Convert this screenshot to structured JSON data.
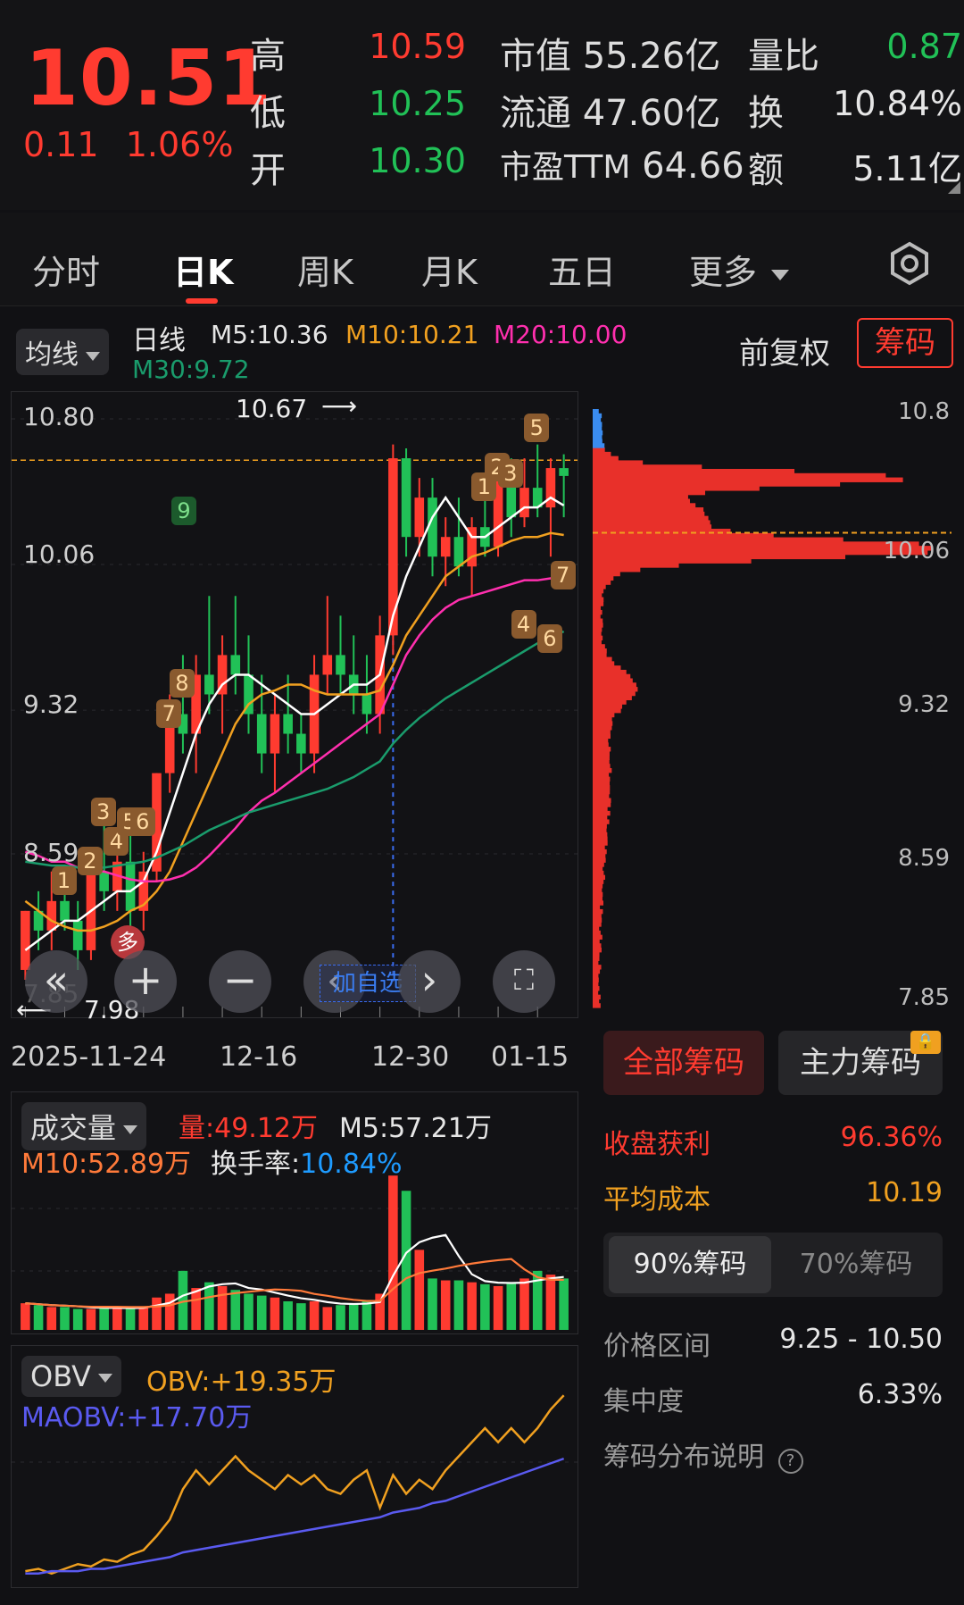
{
  "quote": {
    "price": "10.51",
    "change": "0.11",
    "change_pct": "1.06%",
    "high_label": "高",
    "high": "10.59",
    "low_label": "低",
    "low": "10.25",
    "open_label": "开",
    "open": "10.30",
    "mktcap_label": "市值",
    "mktcap": "55.26亿",
    "float_label": "流通",
    "float": "47.60亿",
    "pe_label": "市盈TTM",
    "pe": "64.66",
    "vol_ratio_label": "量比",
    "vol_ratio": "0.87",
    "turnover_label": "换",
    "turnover": "10.84%",
    "amount_label": "额",
    "amount": "5.11亿"
  },
  "tabs": [
    "分时",
    "日K",
    "周K",
    "月K",
    "五日",
    "更多"
  ],
  "indicator": {
    "selector": "均线",
    "type": "日线",
    "m5": "M5:10.36",
    "m10": "M10:10.21",
    "m20": "M20:10.00",
    "m30": "M30:9.72",
    "adjust": "前复权",
    "chips_btn": "筹码"
  },
  "main_chart": {
    "y_labels": [
      "10.80",
      "10.06",
      "9.32",
      "8.59",
      "7.85"
    ],
    "x_labels": [
      "2025-11-24",
      "12-16",
      "12-30",
      "01-15"
    ],
    "max_label": "10.67",
    "min_label": "7.98",
    "duo_badge": "多",
    "add_watch": "加自选",
    "marker_top9": "9",
    "markers_red": [
      "1",
      "2",
      "3",
      "4",
      "5",
      "6",
      "7",
      "8"
    ],
    "markers_right": [
      "1",
      "2",
      "3",
      "5",
      "7",
      "4",
      "6"
    ]
  },
  "chart_data": {
    "type": "candlestick",
    "x_labels": [
      "2025-11-24",
      "12-16",
      "12-30",
      "01-15"
    ],
    "ylim": [
      7.85,
      10.8
    ],
    "candles": [
      [
        8.0,
        8.3,
        7.95,
        8.3
      ],
      [
        8.3,
        8.4,
        8.1,
        8.2
      ],
      [
        8.2,
        8.5,
        8.1,
        8.35
      ],
      [
        8.35,
        8.45,
        8.2,
        8.25
      ],
      [
        8.25,
        8.35,
        8.0,
        8.1
      ],
      [
        8.1,
        8.6,
        8.05,
        8.5
      ],
      [
        8.5,
        8.8,
        8.3,
        8.4
      ],
      [
        8.4,
        8.7,
        8.3,
        8.55
      ],
      [
        8.55,
        8.7,
        8.2,
        8.3
      ],
      [
        8.3,
        8.6,
        8.2,
        8.5
      ],
      [
        8.5,
        9.0,
        8.45,
        9.0
      ],
      [
        9.0,
        9.4,
        8.9,
        9.3
      ],
      [
        9.3,
        9.6,
        9.1,
        9.2
      ],
      [
        9.2,
        9.6,
        9.0,
        9.5
      ],
      [
        9.5,
        9.9,
        9.3,
        9.4
      ],
      [
        9.4,
        9.7,
        9.2,
        9.6
      ],
      [
        9.6,
        9.9,
        9.4,
        9.5
      ],
      [
        9.5,
        9.7,
        9.2,
        9.3
      ],
      [
        9.3,
        9.5,
        9.0,
        9.1
      ],
      [
        9.1,
        9.4,
        8.9,
        9.3
      ],
      [
        9.3,
        9.5,
        9.1,
        9.2
      ],
      [
        9.2,
        9.3,
        9.0,
        9.1
      ],
      [
        9.1,
        9.6,
        9.0,
        9.5
      ],
      [
        9.5,
        9.9,
        9.4,
        9.6
      ],
      [
        9.6,
        9.8,
        9.4,
        9.5
      ],
      [
        9.5,
        9.7,
        9.3,
        9.4
      ],
      [
        9.4,
        9.6,
        9.2,
        9.3
      ],
      [
        9.3,
        9.8,
        9.2,
        9.7
      ],
      [
        9.7,
        10.67,
        9.6,
        10.6
      ],
      [
        10.6,
        10.65,
        10.1,
        10.2
      ],
      [
        10.2,
        10.5,
        10.1,
        10.4
      ],
      [
        10.4,
        10.5,
        10.0,
        10.1
      ],
      [
        10.1,
        10.3,
        9.95,
        10.2
      ],
      [
        10.2,
        10.4,
        10.0,
        10.05
      ],
      [
        10.05,
        10.3,
        9.9,
        10.25
      ],
      [
        10.25,
        10.5,
        10.1,
        10.15
      ],
      [
        10.15,
        10.55,
        10.1,
        10.5
      ],
      [
        10.5,
        10.6,
        10.2,
        10.3
      ],
      [
        10.3,
        10.6,
        10.25,
        10.45
      ],
      [
        10.45,
        10.67,
        10.3,
        10.35
      ],
      [
        10.35,
        10.6,
        10.1,
        10.55
      ],
      [
        10.55,
        10.62,
        10.3,
        10.51
      ]
    ],
    "series": [
      {
        "name": "M5",
        "color": "#ffffff",
        "values": [
          8.1,
          8.15,
          8.2,
          8.25,
          8.25,
          8.3,
          8.35,
          8.4,
          8.4,
          8.45,
          8.6,
          8.8,
          9.0,
          9.2,
          9.35,
          9.45,
          9.5,
          9.5,
          9.45,
          9.4,
          9.35,
          9.3,
          9.3,
          9.35,
          9.4,
          9.45,
          9.45,
          9.5,
          9.8,
          10.0,
          10.15,
          10.3,
          10.4,
          10.3,
          10.2,
          10.2,
          10.25,
          10.3,
          10.35,
          10.35,
          10.4,
          10.36
        ]
      },
      {
        "name": "M10",
        "color": "#f0a020",
        "values": [
          8.35,
          8.3,
          8.25,
          8.22,
          8.2,
          8.2,
          8.22,
          8.25,
          8.3,
          8.33,
          8.4,
          8.5,
          8.65,
          8.8,
          8.95,
          9.1,
          9.25,
          9.35,
          9.4,
          9.42,
          9.45,
          9.45,
          9.42,
          9.4,
          9.4,
          9.4,
          9.4,
          9.42,
          9.55,
          9.7,
          9.8,
          9.9,
          10.0,
          10.05,
          10.1,
          10.12,
          10.15,
          10.18,
          10.2,
          10.2,
          10.22,
          10.21
        ]
      },
      {
        "name": "M20",
        "color": "#ff2fae",
        "values": [
          8.6,
          8.58,
          8.55,
          8.55,
          8.52,
          8.5,
          8.5,
          8.48,
          8.46,
          8.45,
          8.45,
          8.46,
          8.48,
          8.52,
          8.58,
          8.65,
          8.72,
          8.8,
          8.86,
          8.9,
          8.95,
          9.0,
          9.05,
          9.1,
          9.15,
          9.2,
          9.25,
          9.3,
          9.45,
          9.6,
          9.7,
          9.78,
          9.84,
          9.88,
          9.9,
          9.92,
          9.94,
          9.96,
          9.98,
          9.98,
          9.99,
          10.0
        ]
      },
      {
        "name": "M30",
        "color": "#1a9c6c",
        "values": [
          8.55,
          8.54,
          8.53,
          8.53,
          8.52,
          8.52,
          8.52,
          8.53,
          8.54,
          8.55,
          8.57,
          8.6,
          8.63,
          8.67,
          8.71,
          8.74,
          8.77,
          8.8,
          8.82,
          8.84,
          8.86,
          8.88,
          8.9,
          8.92,
          8.95,
          8.98,
          9.02,
          9.06,
          9.15,
          9.22,
          9.28,
          9.33,
          9.38,
          9.42,
          9.46,
          9.5,
          9.54,
          9.58,
          9.62,
          9.66,
          9.69,
          9.72
        ]
      }
    ]
  },
  "volume": {
    "selector": "成交量",
    "vol": "量:49.12万",
    "m5": "M5:57.21万",
    "m10": "M10:52.89万",
    "turnover_label": "换手率:",
    "turnover": "10.84%"
  },
  "obv": {
    "selector": "OBV",
    "obv": "OBV:+19.35万",
    "maobv": "MAOBV:+17.70万"
  },
  "chips": {
    "y_labels": [
      "10.8",
      "10.06",
      "9.32",
      "8.59",
      "7.85"
    ],
    "tab_all": "全部筹码",
    "tab_main": "主力筹码",
    "profit_label": "收盘获利",
    "profit": "96.36%",
    "avg_cost_label": "平均成本",
    "avg_cost": "10.19",
    "tab_90": "90%筹码",
    "tab_70": "70%筹码",
    "range_label": "价格区间",
    "range": "9.25 - 10.50",
    "concentration_label": "集中度",
    "concentration": "6.33%",
    "help_label": "筹码分布说明"
  },
  "colors": {
    "up": "#ff3b30",
    "down": "#21c157",
    "accent": "#ff3b30",
    "bg": "#111114"
  }
}
